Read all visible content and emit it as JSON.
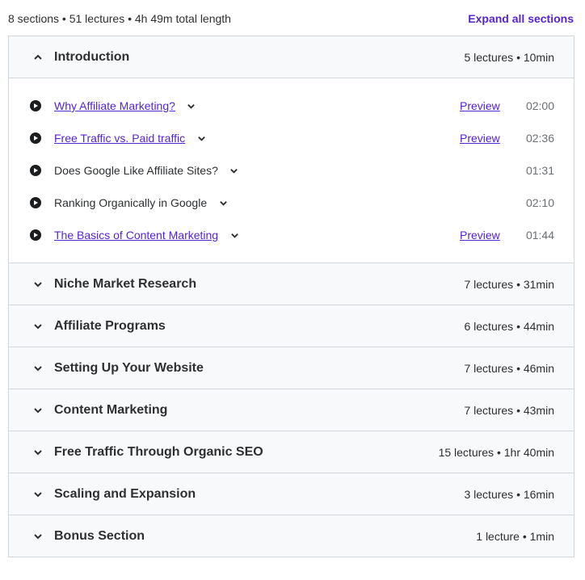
{
  "header": {
    "summary": "8 sections • 51 lectures • 4h 49m total length",
    "expand_all": "Expand all sections"
  },
  "colors": {
    "accent": "#5624d0",
    "section_bg": "#f7f9fa",
    "border": "#d1d7dc"
  },
  "sections": [
    {
      "title": "Introduction",
      "meta": "5 lectures • 10min",
      "expanded": true,
      "lectures": [
        {
          "title": "Why Affiliate Marketing?",
          "preview": "Preview",
          "duration": "02:00",
          "has_preview": true
        },
        {
          "title": "Free Traffic vs. Paid traffic",
          "preview": "Preview",
          "duration": "02:36",
          "has_preview": true
        },
        {
          "title": "Does Google Like Affiliate Sites?",
          "preview": "",
          "duration": "01:31",
          "has_preview": false
        },
        {
          "title": "Ranking Organically in Google",
          "preview": "",
          "duration": "02:10",
          "has_preview": false
        },
        {
          "title": "The Basics of Content Marketing",
          "preview": "Preview",
          "duration": "01:44",
          "has_preview": true
        }
      ]
    },
    {
      "title": "Niche Market Research",
      "meta": "7 lectures • 31min",
      "expanded": false
    },
    {
      "title": "Affiliate Programs",
      "meta": "6 lectures • 44min",
      "expanded": false
    },
    {
      "title": "Setting Up Your Website",
      "meta": "7 lectures • 46min",
      "expanded": false
    },
    {
      "title": "Content Marketing",
      "meta": "7 lectures • 43min",
      "expanded": false
    },
    {
      "title": "Free Traffic Through Organic SEO",
      "meta": "15 lectures • 1hr 40min",
      "expanded": false
    },
    {
      "title": "Scaling and Expansion",
      "meta": "3 lectures • 16min",
      "expanded": false
    },
    {
      "title": "Bonus Section",
      "meta": "1 lecture • 1min",
      "expanded": false
    }
  ]
}
